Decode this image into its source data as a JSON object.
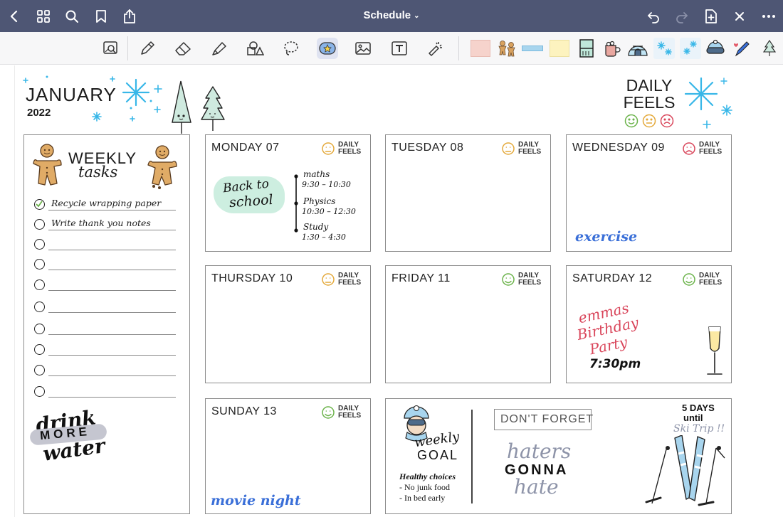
{
  "nav": {
    "title": "Schedule",
    "left_icons": [
      "back-icon",
      "grid-icon",
      "search-icon",
      "bookmark-icon",
      "share-icon"
    ],
    "right_icons": [
      "undo-icon",
      "redo-icon",
      "add-page-icon",
      "close-icon",
      "more-icon"
    ]
  },
  "toolbar": {
    "tools": [
      "zoom-window-icon",
      "pen-icon",
      "eraser-icon",
      "highlighter-icon",
      "shapes-icon",
      "lasso-icon",
      "elements-icon",
      "image-icon",
      "text-icon",
      "laser-pointer-icon"
    ],
    "active_tool": "elements-icon",
    "stickers": [
      "pink-tape",
      "gingerbread",
      "blue-tape",
      "yellow-note",
      "window",
      "cocoa-mug",
      "igloo",
      "snowflakes-1",
      "snowflakes-2",
      "ski-goggles",
      "pen-heart",
      "tree"
    ]
  },
  "planner": {
    "month": "JANUARY",
    "year": "2022",
    "daily_feels": "DAILY FEELS",
    "daily_feels_line1": "DAILY",
    "daily_feels_line2": "FEELS"
  },
  "weekly_tasks": {
    "title": "WEEKLY",
    "subtitle": "tasks",
    "items": [
      {
        "text": "Recycle wrapping paper",
        "done": true
      },
      {
        "text": "Write thank you notes",
        "done": false
      },
      {
        "text": "",
        "done": false
      },
      {
        "text": "",
        "done": false
      },
      {
        "text": "",
        "done": false
      },
      {
        "text": "",
        "done": false
      },
      {
        "text": "",
        "done": false
      },
      {
        "text": "",
        "done": false
      },
      {
        "text": "",
        "done": false
      },
      {
        "text": "",
        "done": false
      }
    ],
    "drink_word1": "drink",
    "drink_word2": "MORE",
    "drink_word3": "water"
  },
  "days": [
    {
      "name": "MONDAY 07",
      "mood": "neutral"
    },
    {
      "name": "TUESDAY 08",
      "mood": "neutral"
    },
    {
      "name": "WEDNESDAY 09",
      "mood": "sad"
    },
    {
      "name": "THURSDAY 10",
      "mood": "neutral"
    },
    {
      "name": "FRIDAY 11",
      "mood": "happy"
    },
    {
      "name": "SATURDAY 12",
      "mood": "happy"
    },
    {
      "name": "SUNDAY 13",
      "mood": "happy"
    }
  ],
  "notes": {
    "back_to_school_1": "Back to",
    "back_to_school_2": "school",
    "schedule": [
      {
        "subject": "maths",
        "time": "9:30 – 10:30"
      },
      {
        "subject": "Physics",
        "time": "10:30 – 12:30"
      },
      {
        "subject": "Study",
        "time": "1:30 – 4:30"
      }
    ],
    "wednesday": "exercise",
    "birthday_1": "emmas",
    "birthday_2": "Birthday",
    "birthday_3": "Party",
    "birthday_time": "7:30pm",
    "sunday": "movie night"
  },
  "goal": {
    "weekly": "weekly",
    "goal": "GOAL",
    "healthy": "Healthy choices",
    "items": [
      "- No junk food",
      "- In bed early"
    ],
    "dont_forget": "DON'T FORGET",
    "haters": "haters",
    "gonna": "GONNA",
    "hate": "hate",
    "days_count": "5 DAYS",
    "until": "until",
    "ski_trip": "Ski Trip !!"
  },
  "colors": {
    "nav_bg": "#4e5674",
    "mood_happy": "#6bb34a",
    "mood_neutral": "#e4a93a",
    "mood_sad": "#d9455a",
    "snow_blue": "#38b7e8",
    "ink_blue": "#3a6fd8",
    "ink_red": "#d9455a",
    "mint": "#cdeee0"
  }
}
